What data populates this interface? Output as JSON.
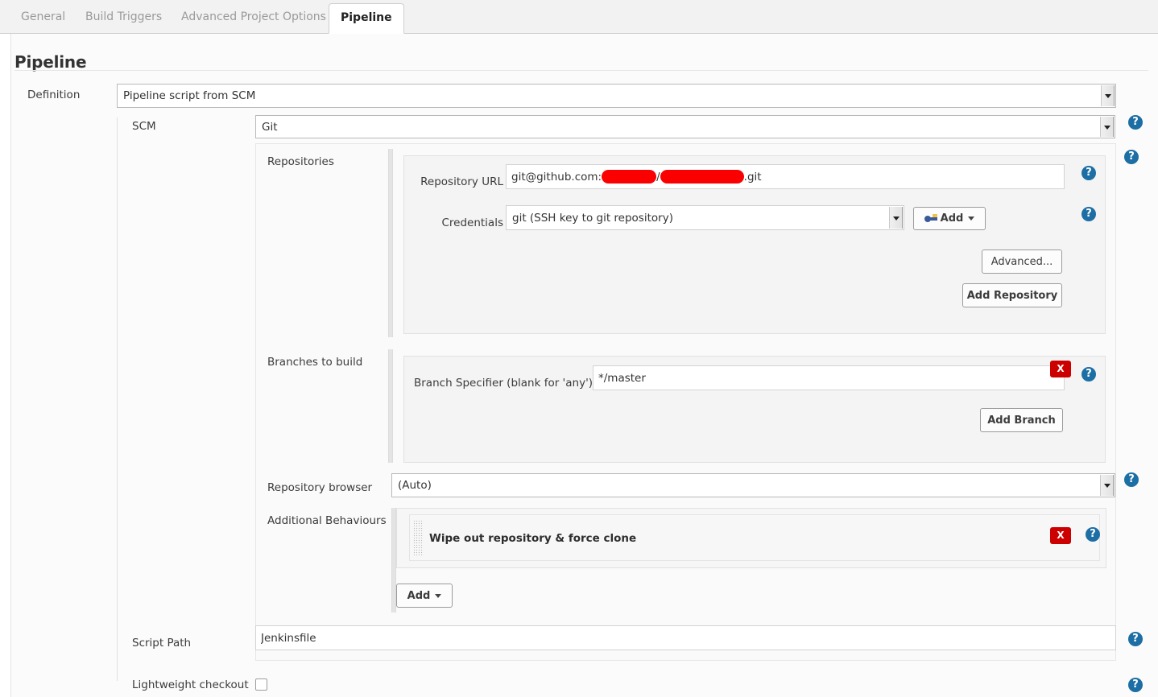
{
  "tabs": [
    {
      "label": "General",
      "active": false
    },
    {
      "label": "Build Triggers",
      "active": false
    },
    {
      "label": "Advanced Project Options",
      "active": false
    },
    {
      "label": "Pipeline",
      "active": true
    }
  ],
  "page": {
    "title": "Pipeline"
  },
  "definition": {
    "label": "Definition",
    "value": "Pipeline script from SCM"
  },
  "scm": {
    "label": "SCM",
    "value": "Git"
  },
  "repositories": {
    "label": "Repositories",
    "url_label": "Repository URL",
    "url_prefix": "git@github.com:",
    "url_separator": "/",
    "url_suffix": ".git",
    "credentials_label": "Credentials",
    "credentials_value": "git (SSH key to git repository)",
    "add_credentials_label": "Add",
    "advanced_label": "Advanced...",
    "add_repository_label": "Add Repository"
  },
  "branches": {
    "label": "Branches to build",
    "specifier_label": "Branch Specifier (blank for 'any')",
    "specifier_value": "*/master",
    "add_branch_label": "Add Branch",
    "delete_label": "X"
  },
  "repo_browser": {
    "label": "Repository browser",
    "value": "(Auto)"
  },
  "additional_behaviours": {
    "label": "Additional Behaviours",
    "items": [
      {
        "title": "Wipe out repository & force clone",
        "delete_label": "X"
      }
    ],
    "add_label": "Add"
  },
  "script_path": {
    "label": "Script Path",
    "value": "Jenkinsfile"
  },
  "lightweight": {
    "label": "Lightweight checkout",
    "checked": false
  },
  "icons": {
    "help": "?",
    "caret_down": "▾"
  },
  "colors": {
    "accent_help": "#1c6ea4",
    "danger": "#cc0000",
    "redaction": "#fb0000",
    "key_blue": "#3b5998",
    "key_yellow": "#f2c14e"
  }
}
